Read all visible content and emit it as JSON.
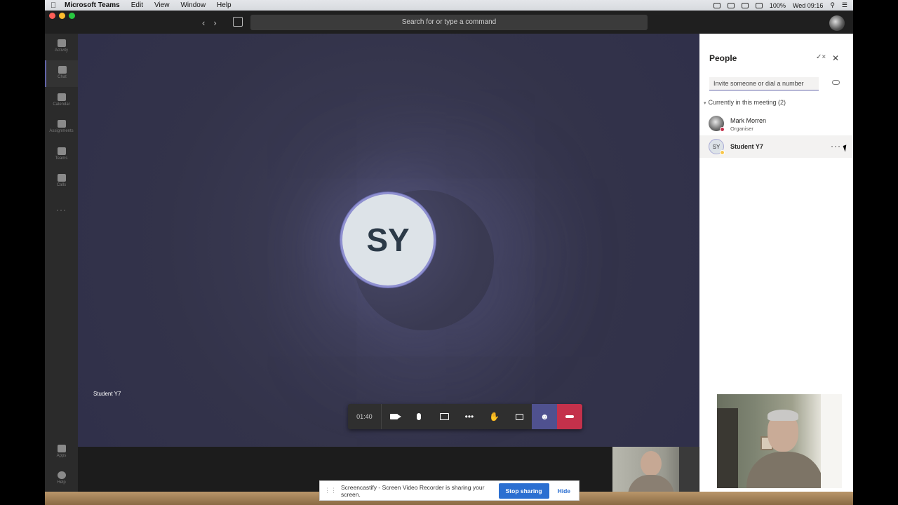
{
  "menubar": {
    "app": "Microsoft Teams",
    "items": [
      "Edit",
      "View",
      "Window",
      "Help"
    ],
    "battery": "100%",
    "clock": "Wed 09:16"
  },
  "titlebar": {
    "search_placeholder": "Search for or type a command"
  },
  "rail": {
    "items": [
      {
        "label": "Activity",
        "icon": "bell-icon"
      },
      {
        "label": "Chat",
        "icon": "chat-icon"
      },
      {
        "label": "Calendar",
        "icon": "calendar-icon"
      },
      {
        "label": "Assignments",
        "icon": "assignments-icon"
      },
      {
        "label": "Teams",
        "icon": "teams-icon"
      },
      {
        "label": "Calls",
        "icon": "phone-icon"
      }
    ],
    "more": "···",
    "bottom": [
      {
        "label": "Apps",
        "icon": "apps-icon"
      },
      {
        "label": "Help",
        "icon": "help-icon"
      }
    ]
  },
  "meeting": {
    "avatar_initials": "SY",
    "participant_label": "Student Y7",
    "timer": "01:40"
  },
  "people_panel": {
    "title": "People",
    "invite_placeholder": "Invite someone or dial a number",
    "section_label": "Currently in this meeting (2)",
    "participants": [
      {
        "name": "Mark Morren",
        "role": "Organiser",
        "status_color": "#c4314b"
      },
      {
        "name": "Student Y7",
        "initials": "SY",
        "status_color": "#f8c74b",
        "more": "···"
      }
    ]
  },
  "sharebar": {
    "message": "Screencastify - Screen Video Recorder is sharing your screen.",
    "stop_label": "Stop sharing",
    "hide_label": "Hide"
  },
  "colors": {
    "accent": "#6264a7",
    "hangup": "#c4314b",
    "share_blue": "#2b6fd1"
  }
}
